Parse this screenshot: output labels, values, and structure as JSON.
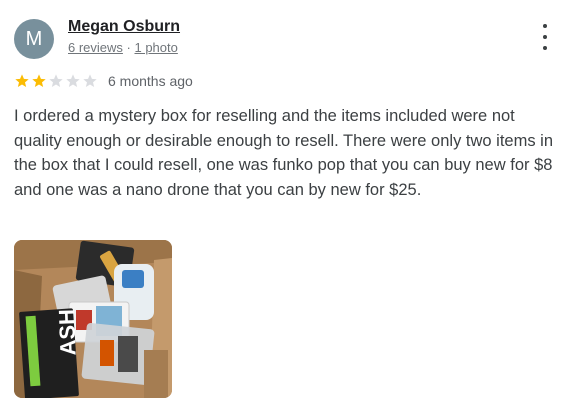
{
  "review": {
    "avatar_letter": "M",
    "avatar_color": "#78909c",
    "reviewer_name": "Megan Osburn",
    "reviews_count": "6 reviews",
    "meta_separator": " · ",
    "photos_count": "1 photo",
    "rating": 2,
    "rating_max": 5,
    "star_color": "#fbbc04",
    "star_empty_color": "#dadce0",
    "date": "6 months ago",
    "text": "I ordered a mystery box for reselling and the items included were not quality enough or desirable enough to resell. There were only two items in the box that I could resell, one was funko pop that you can buy new for $8 and one was a nano drone that you can by new for $25.",
    "more_icon": "more-vert-icon"
  },
  "photo": {
    "carton_label": "ASH"
  }
}
